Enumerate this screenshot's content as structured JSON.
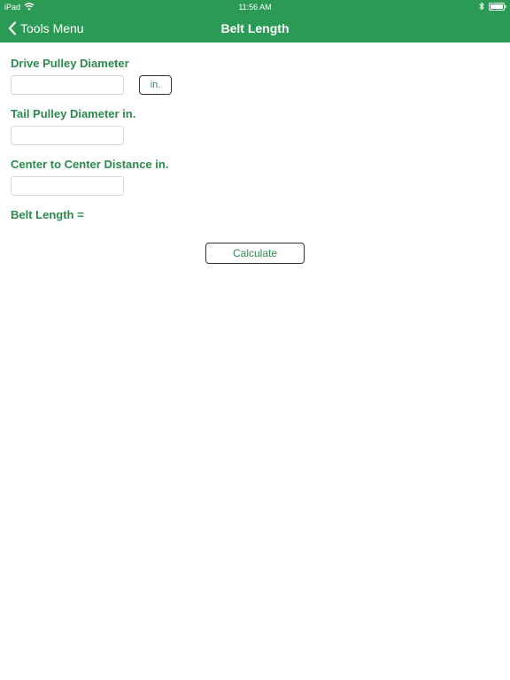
{
  "status_bar": {
    "carrier": "iPad",
    "time": "11:56 AM"
  },
  "nav": {
    "back_label": "Tools Menu",
    "title": "Belt Length"
  },
  "form": {
    "drive_pulley_label": "Drive Pulley Diameter",
    "drive_pulley_value": "",
    "unit_button_label": "in.",
    "tail_pulley_label": "Tail Pulley Diameter in.",
    "tail_pulley_value": "",
    "center_distance_label": "Center to Center Distance in.",
    "center_distance_value": "",
    "result_label": "Belt Length =",
    "calculate_label": "Calculate"
  },
  "icons": {
    "wifi": "wifi-icon",
    "bluetooth": "bluetooth-icon",
    "battery": "battery-icon",
    "back": "chevron-left-icon"
  },
  "colors": {
    "header_bg": "#2b9a55",
    "label_green": "#2b8a4c",
    "background": "#ffffff"
  }
}
